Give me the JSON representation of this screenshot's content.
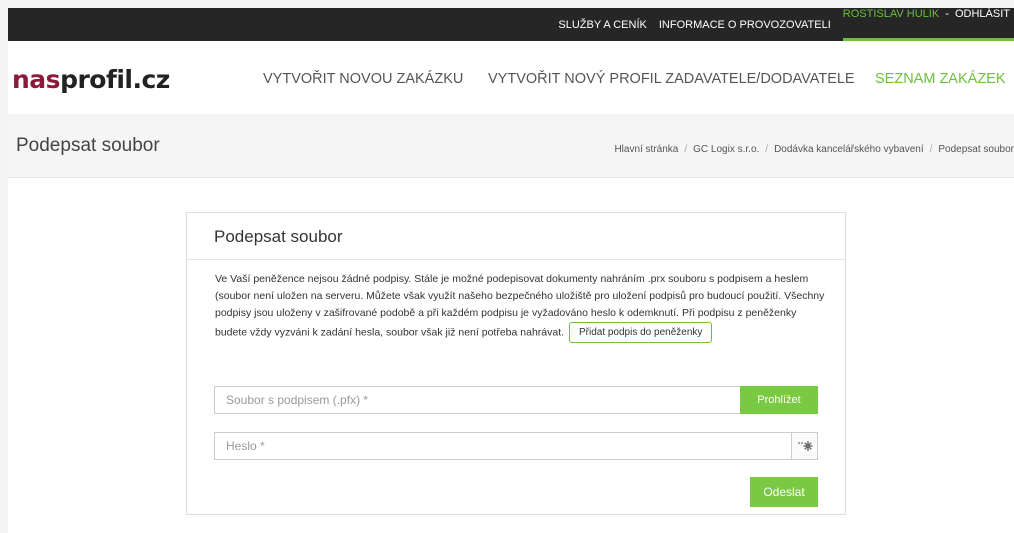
{
  "topbar": {
    "services": "SLUŽBY A CENÍK",
    "operator_info": "INFORMACE O PROVOZOVATELI",
    "user_name": "ROSTISLAV HULIK",
    "separator": " - ",
    "logout": "ODHLÁSIT"
  },
  "logo": {
    "part1": "nas",
    "part2": "profil.cz"
  },
  "nav": {
    "new_order": "VYTVOŘIT NOVOU ZAKÁZKU",
    "new_profile": "VYTVOŘIT NOVÝ PROFIL ZADAVATELE/DODAVATELE",
    "order_list": "SEZNAM ZAKÁZEK"
  },
  "page_title": "Podepsat soubor",
  "breadcrumbs": [
    "Hlavní stránka",
    "GC Logix s.r.o.",
    "Dodávka kancelářského vybavení",
    "Podepsat soubor"
  ],
  "panel": {
    "heading": "Podepsat soubor",
    "info_text": "Ve Vaší peněžence nejsou žádné podpisy. Stále je možné podepisovat dokumenty nahráním .prx souboru s podpisem a heslem (soubor není uložen na serveru. Můžete však využít našeho bezpečného uložiště pro uložení podpisů pro budoucí použití. Všechny podpisy jsou uloženy v zašifrované podobě a při každém podpisu je vyžadováno heslo k odemknutí. Při podpisu z peněženky budete vždy vyzváni k zadání hesla, soubor však již není potřeba nahrávat.",
    "add_to_wallet_label": "Přidat podpis do peněženky",
    "file_placeholder": "Soubor s podpisem (.pfx) *",
    "browse_label": "Prohlížet",
    "password_placeholder": "Heslo *",
    "password_toggle_icon": "eye-icon",
    "submit_label": "Odeslat"
  },
  "colors": {
    "accent": "#7ac943",
    "active_nav": "#6cc03c",
    "logo_dark_red": "#8b1a3a",
    "topbar_bg": "#262626"
  }
}
